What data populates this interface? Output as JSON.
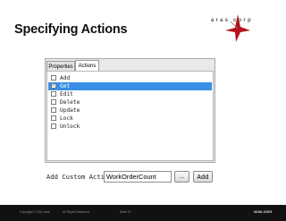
{
  "slide": {
    "title": "Specifying Actions"
  },
  "logo": {
    "text": "aras corp"
  },
  "tabs": {
    "properties": "Properties",
    "actions": "Actions"
  },
  "actions_list": [
    {
      "label": "Add",
      "checked": false,
      "selected": false
    },
    {
      "label": "Get",
      "checked": true,
      "selected": true
    },
    {
      "label": "Edit",
      "checked": false,
      "selected": false
    },
    {
      "label": "Delete",
      "checked": false,
      "selected": false
    },
    {
      "label": "Update",
      "checked": false,
      "selected": false
    },
    {
      "label": "Lock",
      "checked": false,
      "selected": false
    },
    {
      "label": "Unlock",
      "checked": false,
      "selected": false
    }
  ],
  "custom_action": {
    "label": "Add Custom Action:",
    "value": "WorkOrderCount",
    "browse_label": "...",
    "add_label": "Add"
  },
  "footer": {
    "copyright": "Copyright © 2011 Aras",
    "rights": "All Rights Reserved.",
    "slide_no": "Slide 20",
    "site": "aras.com"
  },
  "colors": {
    "selection": "#3a8ee6",
    "brand_red": "#b5121b",
    "footer_bg": "#111111"
  }
}
